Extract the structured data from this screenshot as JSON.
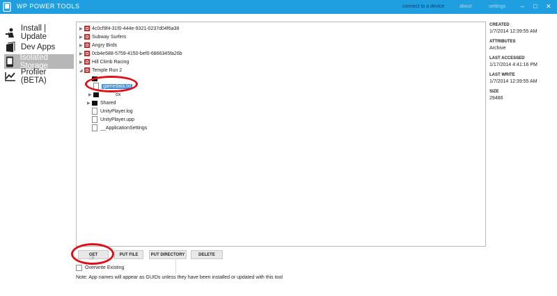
{
  "window": {
    "title": "WP POWER TOOLS",
    "links": {
      "connect": "connect to a device",
      "about": "about",
      "settings": "settings"
    },
    "controls": {
      "minimize": "–",
      "maximize": "□",
      "close": "✕"
    }
  },
  "nav": {
    "items": [
      {
        "label": "Install | Update",
        "icon": "install-icon"
      },
      {
        "label": "Dev Apps",
        "icon": "dev-apps-icon"
      },
      {
        "label": "Isolated Storage",
        "icon": "phone-icon",
        "active": true
      },
      {
        "label": "Profiler (BETA)",
        "icon": "profiler-icon"
      }
    ]
  },
  "tree": {
    "apps": [
      "4c0cf9f4-31f0-444e-9321-0237d04f6a38",
      "Subway Surfers",
      "Angry Birds",
      "0cb4e588-5759-4150-bef0-6866345fa26b",
      "Hill Climb Racing",
      "Temple Run 2"
    ],
    "children": {
      "partial_folder": "ox",
      "selected_file": "gamedata.txt",
      "shared": "Shared",
      "files": [
        "UnityPlayer.log",
        "UnityPlayer.upp",
        "__ApplicationSettings"
      ]
    }
  },
  "details": {
    "created_label": "CREATED",
    "created": "1/7/2014 12:39:55 AM",
    "attributes_label": "ATTRIBUTES",
    "attributes": "Archive",
    "last_accessed_label": "LAST ACCESSED",
    "last_accessed": "1/17/2014 4:41:16 PM",
    "last_write_label": "LAST WRITE",
    "last_write": "1/7/2014 12:39:55 AM",
    "size_label": "SIZE",
    "size": "29486"
  },
  "actions": {
    "get": "GET",
    "put_file": "PUT FILE",
    "put_directory": "PUT DIRECTORY",
    "delete": "DELETE"
  },
  "overwrite_label": "Overwrite Existing",
  "note": "Note: App names will appear as GUIDs unless they have been installed or updated with this tool",
  "colors": {
    "titlebar": "#1f9fe0",
    "annotation": "#e0101a",
    "selection": "#3a8fdf",
    "app_badge": "#e02020"
  }
}
